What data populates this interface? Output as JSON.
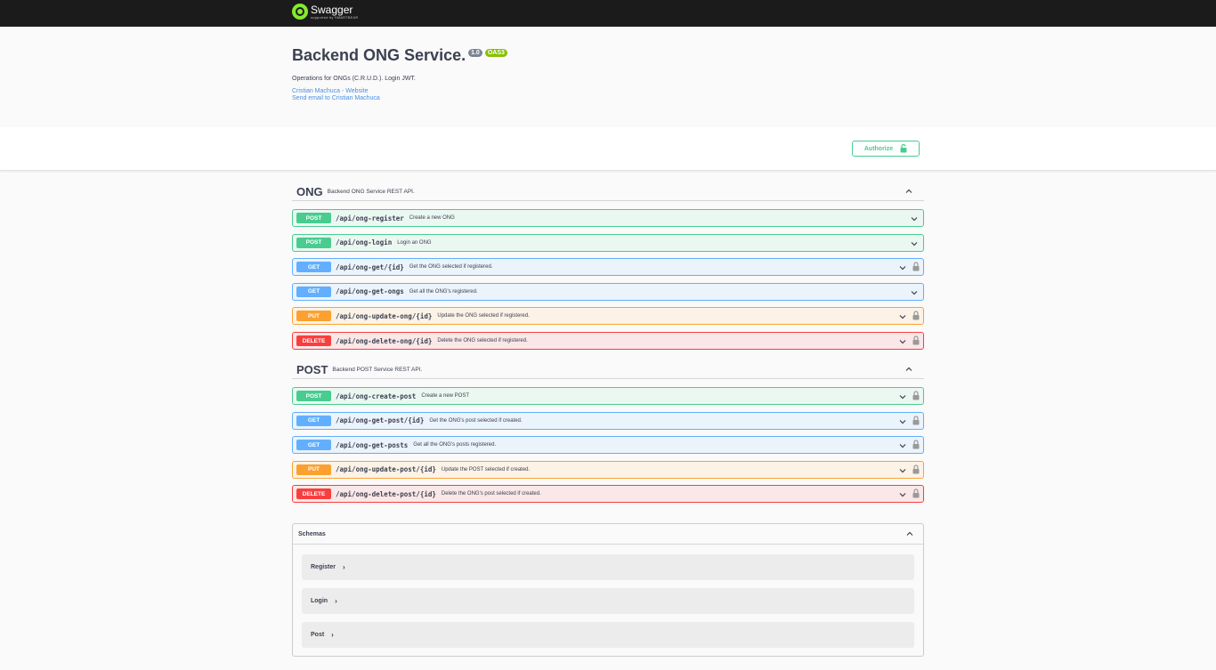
{
  "topbar": {
    "brand": "Swagger",
    "brand_sub": "supported by SMARTBEAR"
  },
  "info": {
    "title": "Backend ONG Service.",
    "version": "1.0",
    "oas": "OAS3",
    "description": "Operations for ONGs (C.R.U.D.). Login JWT.",
    "links": [
      "Cristian Machuca - Website",
      "Send email to Cristian Machuca"
    ]
  },
  "authorize_label": "Authorize",
  "tags": [
    {
      "name": "ONG",
      "description": "Backend ONG Service REST API.",
      "operations": [
        {
          "method": "POST",
          "path": "/api/ong-register",
          "summary": "Create a new ONG",
          "locked": false
        },
        {
          "method": "POST",
          "path": "/api/ong-login",
          "summary": "Login an ONG",
          "locked": false
        },
        {
          "method": "GET",
          "path": "/api/ong-get/{id}",
          "summary": "Get the ONG selected if registered.",
          "locked": true
        },
        {
          "method": "GET",
          "path": "/api/ong-get-ongs",
          "summary": "Get all the ONG's registered.",
          "locked": false
        },
        {
          "method": "PUT",
          "path": "/api/ong-update-ong/{id}",
          "summary": "Update the ONG selected if registered.",
          "locked": true
        },
        {
          "method": "DELETE",
          "path": "/api/ong-delete-ong/{id}",
          "summary": "Delete the ONG selected if registered.",
          "locked": true
        }
      ]
    },
    {
      "name": "POST",
      "description": "Backend POST Service REST API.",
      "operations": [
        {
          "method": "POST",
          "path": "/api/ong-create-post",
          "summary": "Create a new POST",
          "locked": true
        },
        {
          "method": "GET",
          "path": "/api/ong-get-post/{id}",
          "summary": "Get the ONG's post selected if created.",
          "locked": true
        },
        {
          "method": "GET",
          "path": "/api/ong-get-posts",
          "summary": "Get all the ONG's posts registered.",
          "locked": true
        },
        {
          "method": "PUT",
          "path": "/api/ong-update-post/{id}",
          "summary": "Update the POST selected if created.",
          "locked": true
        },
        {
          "method": "DELETE",
          "path": "/api/ong-delete-post/{id}",
          "summary": "Delete the ONG's post selected if created.",
          "locked": true
        }
      ]
    }
  ],
  "schemas": {
    "title": "Schemas",
    "models": [
      "Register",
      "Login",
      "Post"
    ]
  },
  "colors": {
    "post": "#49cc90",
    "get": "#61affe",
    "put": "#fca130",
    "delete": "#f93e3e",
    "topbar": "#1b1b1b",
    "brand": "#85ea2d"
  }
}
